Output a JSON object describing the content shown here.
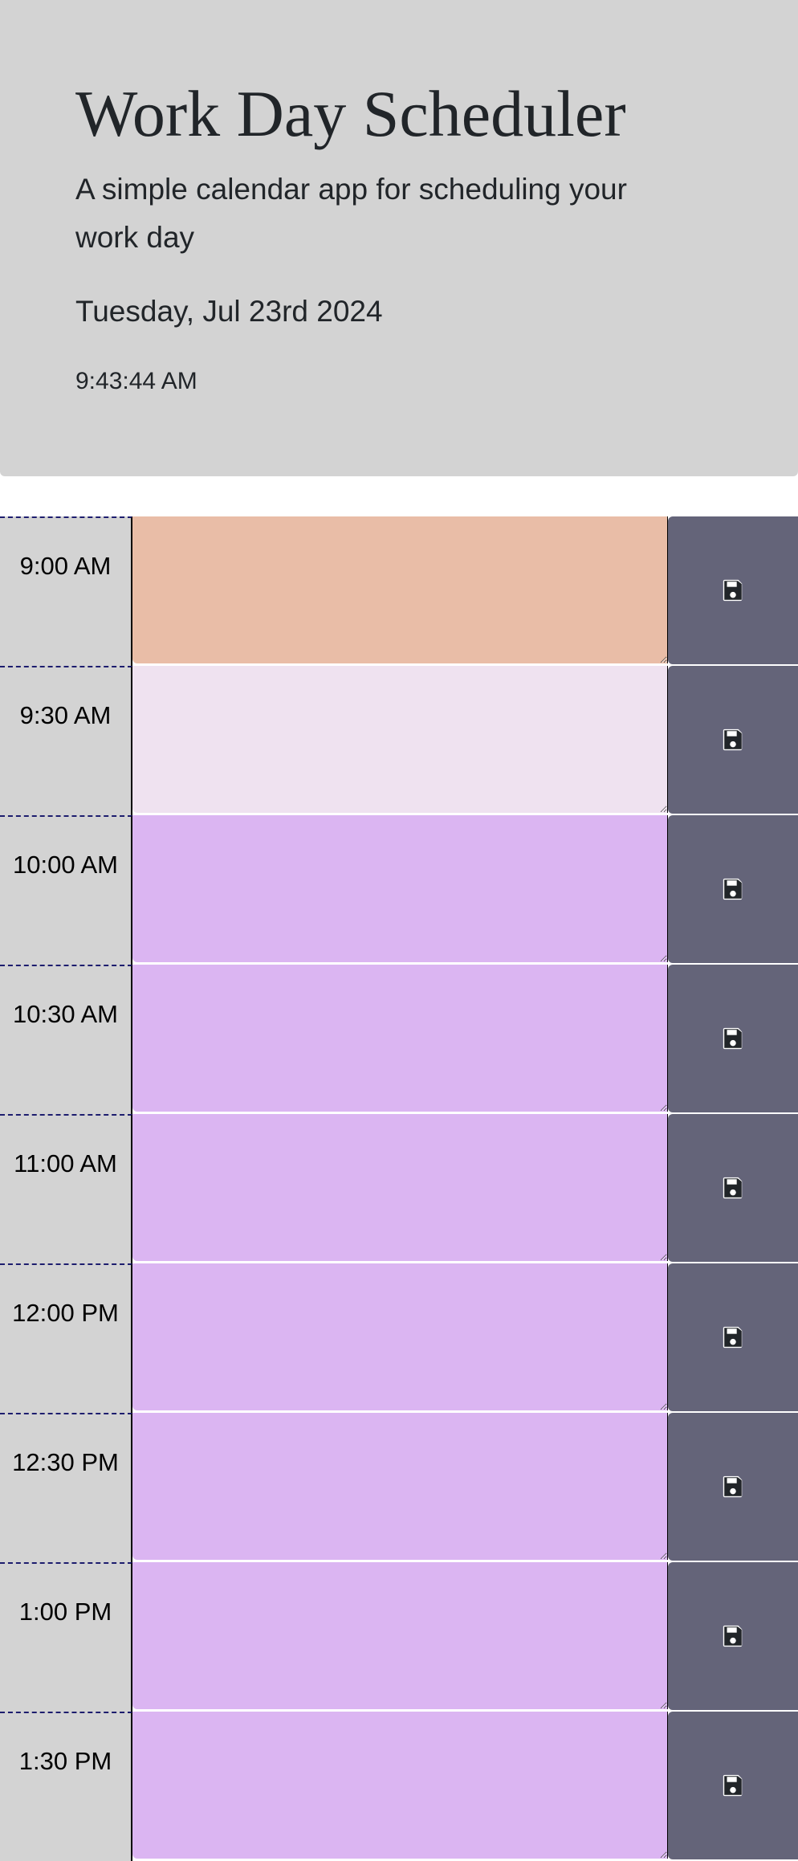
{
  "header": {
    "title": "Work Day Scheduler",
    "lead": "A simple calendar app for scheduling your work day",
    "current_day": "Tuesday, Jul 23rd 2024",
    "current_time": "9:43:44 AM"
  },
  "colors": {
    "past": "#e9bda7",
    "present": "#efe2f0",
    "future": "#dbb5f2",
    "hour_bg": "#d3d3d3",
    "save_button": "#646479",
    "jumbotron": "#d3d3d3"
  },
  "icons": {
    "save": "floppy-disk-icon"
  },
  "time_blocks": [
    {
      "hour": "9:00 AM",
      "state": "past",
      "text": ""
    },
    {
      "hour": "9:30 AM",
      "state": "present",
      "text": ""
    },
    {
      "hour": "10:00 AM",
      "state": "future",
      "text": ""
    },
    {
      "hour": "10:30 AM",
      "state": "future",
      "text": ""
    },
    {
      "hour": "11:00 AM",
      "state": "future",
      "text": ""
    },
    {
      "hour": "12:00 PM",
      "state": "future",
      "text": ""
    },
    {
      "hour": "12:30 PM",
      "state": "future",
      "text": ""
    },
    {
      "hour": "1:00 PM",
      "state": "future",
      "text": ""
    },
    {
      "hour": "1:30 PM",
      "state": "future",
      "text": ""
    }
  ]
}
